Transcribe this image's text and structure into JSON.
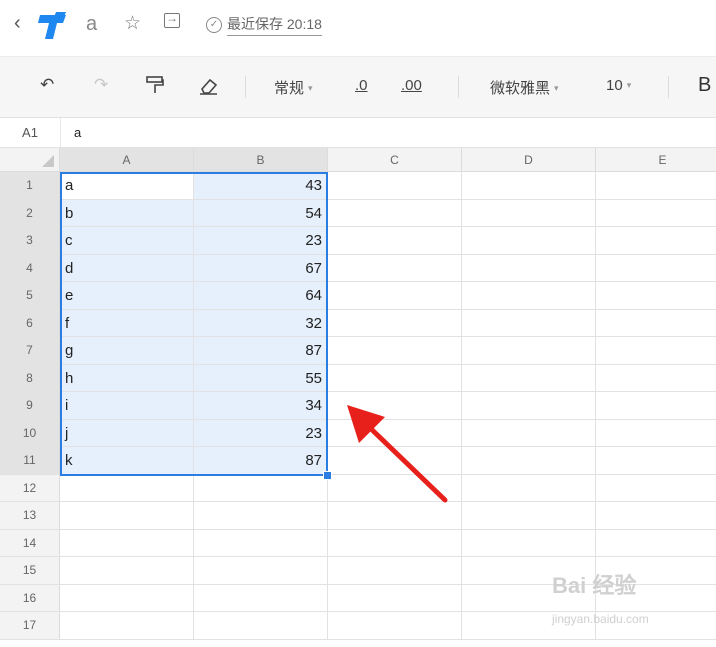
{
  "titlebar": {
    "doc_name": "a",
    "saved_status": "最近保存 20:18",
    "back_glyph": "‹",
    "star_glyph": "☆",
    "check_glyph": "✓"
  },
  "toolbar": {
    "undo_glyph": "↶",
    "redo_glyph": "↷",
    "number_format": "常规",
    "decrease_decimal": ".0",
    "increase_decimal": ".00",
    "font_family": "微软雅黑",
    "font_size": "10",
    "bold": "B",
    "caret": "▾"
  },
  "formula_bar": {
    "cell_ref": "A1",
    "value": "a"
  },
  "columns": [
    "A",
    "B",
    "C",
    "D",
    "E"
  ],
  "rows": [
    {
      "num": "1",
      "a": "a",
      "b": "43"
    },
    {
      "num": "2",
      "a": "b",
      "b": "54"
    },
    {
      "num": "3",
      "a": "c",
      "b": "23"
    },
    {
      "num": "4",
      "a": "d",
      "b": "67"
    },
    {
      "num": "5",
      "a": "e",
      "b": "64"
    },
    {
      "num": "6",
      "a": "f",
      "b": "32"
    },
    {
      "num": "7",
      "a": "g",
      "b": "87"
    },
    {
      "num": "8",
      "a": "h",
      "b": "55"
    },
    {
      "num": "9",
      "a": "i",
      "b": "34"
    },
    {
      "num": "10",
      "a": "j",
      "b": "23"
    },
    {
      "num": "11",
      "a": "k",
      "b": "87"
    },
    {
      "num": "12",
      "a": "",
      "b": ""
    },
    {
      "num": "13",
      "a": "",
      "b": ""
    },
    {
      "num": "14",
      "a": "",
      "b": ""
    },
    {
      "num": "15",
      "a": "",
      "b": ""
    },
    {
      "num": "16",
      "a": "",
      "b": ""
    },
    {
      "num": "17",
      "a": "",
      "b": ""
    }
  ],
  "selection_rows": 11,
  "watermark": {
    "brand": "Bai 经验",
    "url": "jingyan.baidu.com"
  },
  "colors": {
    "selection": "#2b7de1",
    "arrow": "#e8201c",
    "logo": "#1e88f0"
  }
}
